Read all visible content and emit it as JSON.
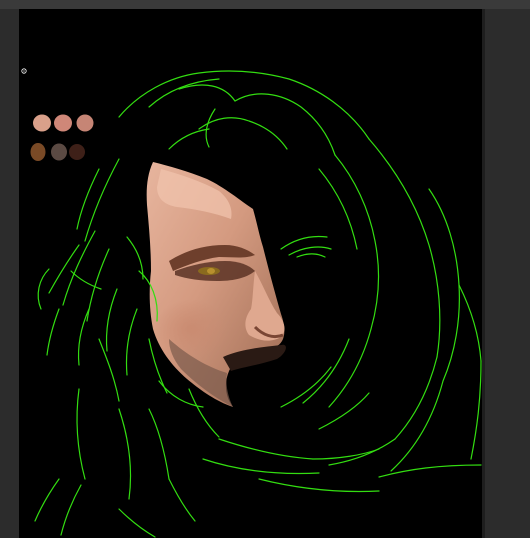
{
  "app": {
    "workspace_color": "#2c2c2c",
    "canvas_color": "#000000",
    "sketch_line_color": "#33dd11"
  },
  "palette": {
    "label": "",
    "swatches": [
      {
        "name": "light-skin",
        "color": "#d9a08a"
      },
      {
        "name": "pink-skin",
        "color": "#cf8778"
      },
      {
        "name": "rose-skin",
        "color": "#c68575"
      },
      {
        "name": "brown",
        "color": "#7a4a26"
      },
      {
        "name": "gray-brown",
        "color": "#5b4a43"
      },
      {
        "name": "dark-brown",
        "color": "#3e2018"
      }
    ]
  },
  "tool": {
    "cursor_icon": "brush-cursor-icon"
  }
}
